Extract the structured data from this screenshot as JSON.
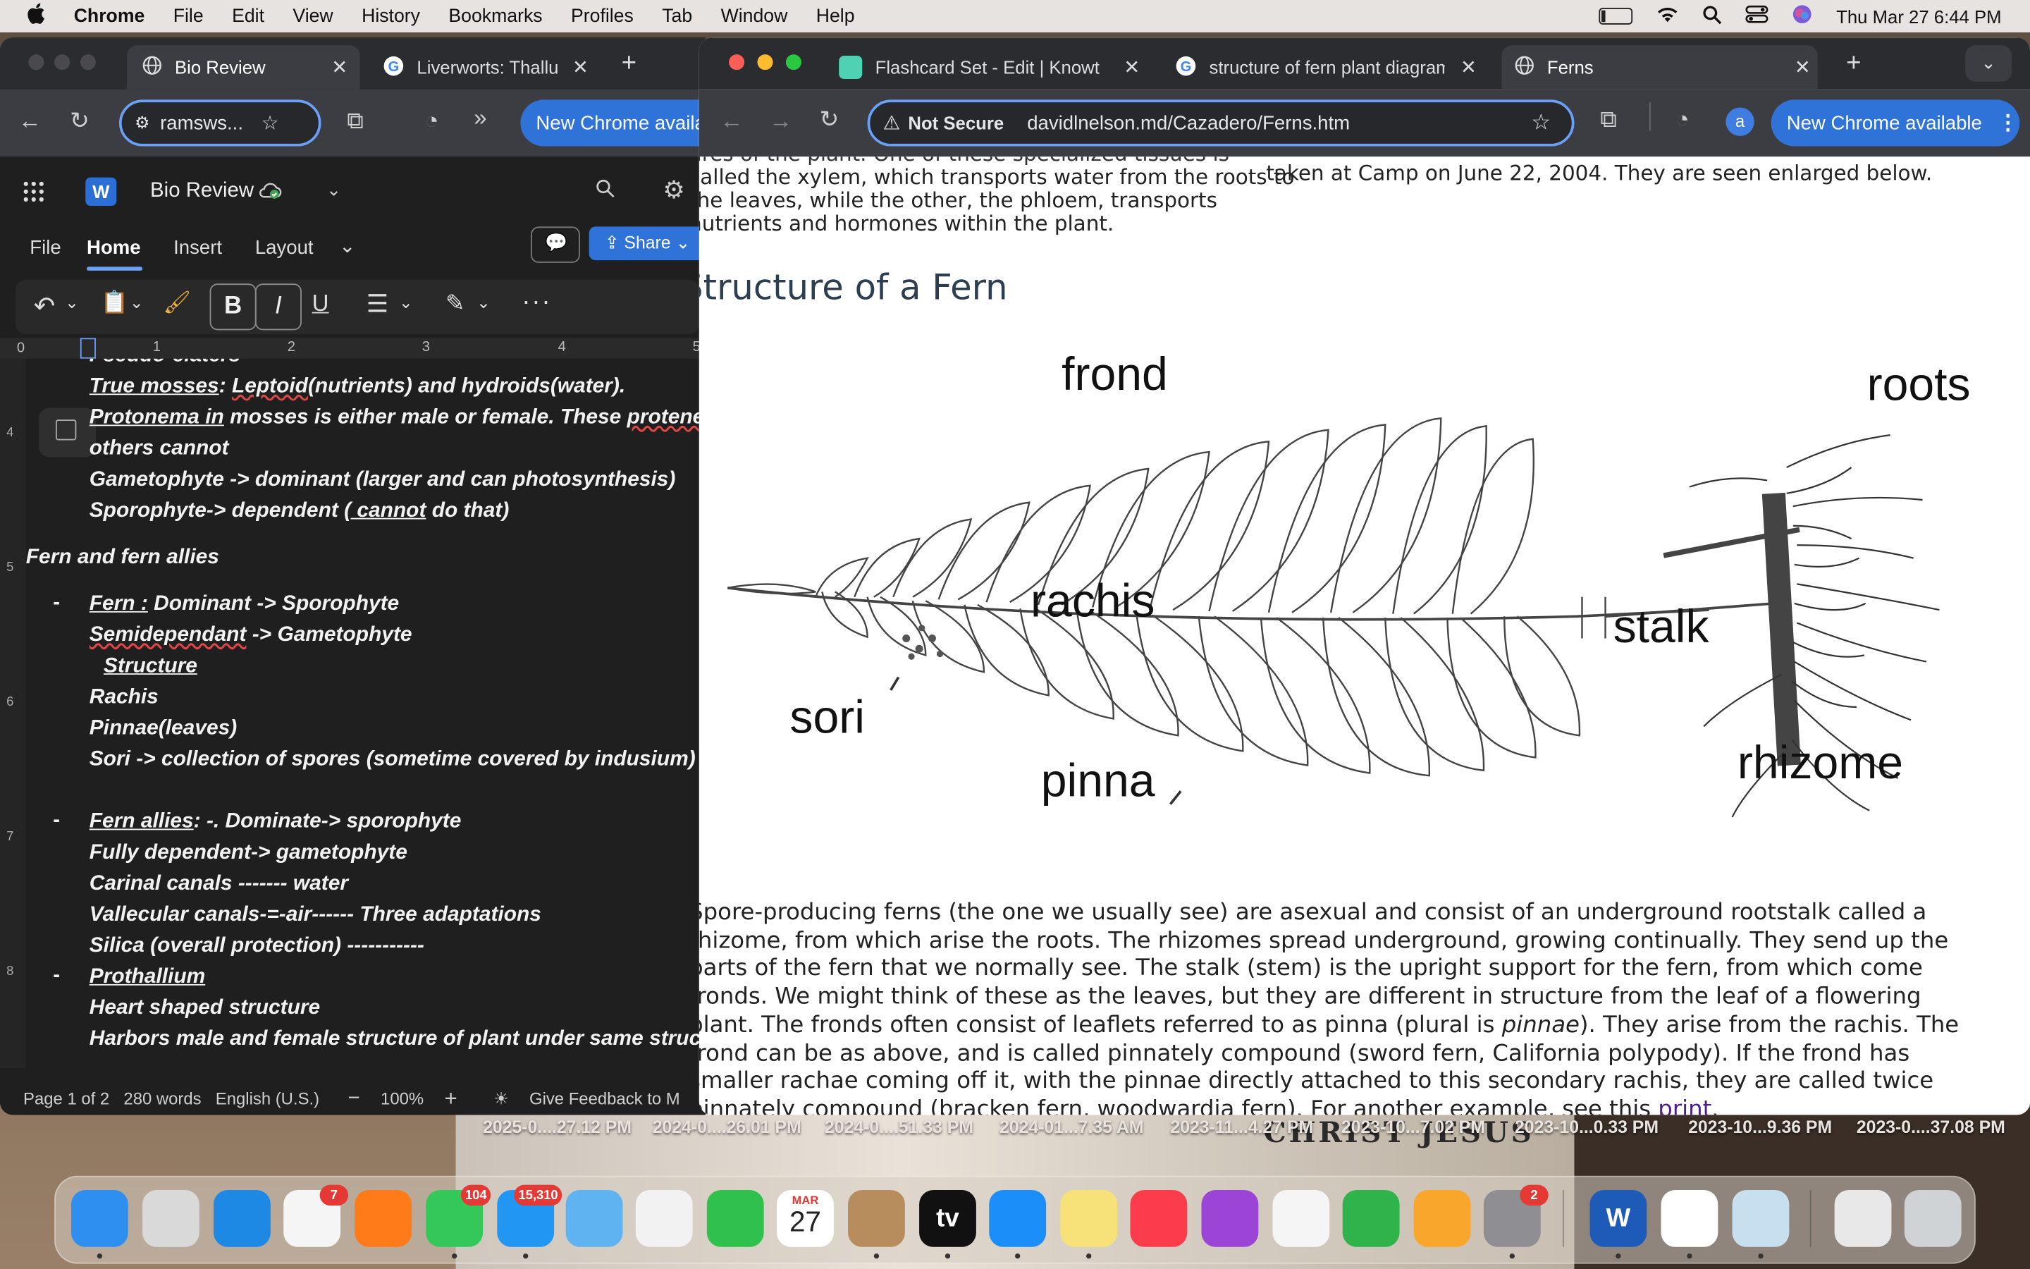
{
  "menubar": {
    "apple": "",
    "app": "Chrome",
    "items": [
      "File",
      "Edit",
      "View",
      "History",
      "Bookmarks",
      "Profiles",
      "Tab",
      "Window",
      "Help"
    ],
    "datetime": "Thu Mar 27  6:44 PM"
  },
  "word_browser": {
    "tabs": [
      {
        "title": "Bio Review",
        "icon": "globe-icon"
      },
      {
        "title": "Liverworts: Thallu",
        "icon": "google-icon"
      }
    ],
    "address": "ramsws...",
    "update_label": "New Chrome availa"
  },
  "word": {
    "doc_title": "Bio Review",
    "menu": [
      "File",
      "Home",
      "Insert",
      "Layout"
    ],
    "share_label": "Share",
    "ruler_marks": [
      "1",
      "2",
      "3",
      "4",
      "5"
    ],
    "margin_nums": [
      "4",
      "5",
      "6",
      "7",
      "8"
    ],
    "lines": {
      "l0": "Pseudo-elaters",
      "l1a": "True mosses",
      "l1b": ": ",
      "l1c": "Leptoid",
      "l1d": "(nutrients) and hydroids(water).",
      "l2a": "Protonema  in",
      "l2b": " mosses is either male or female. These ",
      "l2c": "protene",
      "l3": "others cannot",
      "l4": "Gametophyte -> dominant (larger and can photosynthesis)",
      "l5a": "Sporophyte-> dependent ",
      "l5b": "( cannot",
      "l5c": " do that)",
      "l6": "Fern and fern allies",
      "l7a": "Fern :",
      "l7b": " Dominant -> Sporophyte",
      "l8a": "Semidependant",
      "l8b": " -> Gametophyte",
      "l9": " Structure",
      "l10": "Rachis",
      "l11": "Pinnae(leaves)",
      "l12": "Sori -> collection of spores (sometime covered by indusium)",
      "l13a": "Fern allies",
      "l13b": ": -. Dominate-> sporophyte",
      "l14": "Fully dependent-> gametophyte",
      "l15": "Carinal canals ------- water",
      "l16": "Vallecular canals-=-air------ Three adaptations",
      "l17": "Silica (overall protection) -----------",
      "l18": "Prothallium",
      "l19": "Heart shaped structure",
      "l20": "Harbors male and female structure of plant under same struc"
    },
    "bullet_char": "-",
    "status": {
      "page": "Page 1 of 2",
      "words": "280 words",
      "lang": "English (U.S.)",
      "zoom": "100%",
      "feedback": "Give Feedback to M"
    }
  },
  "chrome": {
    "tabs": [
      {
        "title": "Flashcard Set - Edit | Knowt",
        "icon": "knowt-icon"
      },
      {
        "title": "structure of fern plant diagram",
        "icon": "google-icon"
      },
      {
        "title": "Ferns",
        "icon": "globe-icon",
        "active": true
      }
    ],
    "security": "Not Secure",
    "url": "davidlnelson.md/Cazadero/Ferns.htm",
    "profile_initial": "a",
    "update_label": "New Chrome available"
  },
  "page": {
    "top_left_lines": [
      "called the xylem, which transports water from the roots to",
      "the leaves, while the other, the phloem, transports",
      "nutrients and hormones within the plant."
    ],
    "top_right": "taken at Camp on June 22, 2004. They are seen enlarged below.",
    "heading": "Structure of a Fern",
    "labels": {
      "frond": "frond",
      "roots": "roots",
      "rachis": "rachis",
      "stalk": "stalk",
      "sori": "sori",
      "pinna": "pinna",
      "rhizome": "rhizome"
    },
    "para": [
      "Spore-producing ferns (the one we usually see) are asexual and consist of an underground rootstalk called a",
      "rhizome, from which arise the roots. The rhizomes spread underground, growing continually. They send up the",
      "parts of the fern that we normally see. The stalk (stem) is the upright support for the fern, from which come",
      "fronds. We might think of these as the leaves, but they are different in structure from the leaf of a flowering",
      "plant. The fronds often consist of leaflets referred to as pinna (plural is ",
      "pinnae",
      "). They arise from the rachis. The",
      "frond can be as above, and is called pinnately compound (sword fern, California polypody). If the frond has",
      "smaller rachae coming off it, with the pinnae directly attached to this secondary rachis, they are called twice",
      "pinnately compound (bracken fern, woodwardia fern). For another example, see this ",
      "print",
      "."
    ]
  },
  "desktop": {
    "labels": [
      "2025-0....27.12 PM",
      "2024-0....26.01 PM",
      "2024-0....51.33 PM",
      "2024-01...7.35 AM",
      "2023-11...4.27 PM",
      "2023-10...7.02 PM",
      "2023-10...0.33 PM",
      "2023-10...9.36 PM",
      "2023-0....37.08 PM"
    ],
    "image_text": "CHRIST JESUS"
  },
  "dock": {
    "apps": [
      {
        "name": "Finder",
        "icon": "finder-icon",
        "color": "#2f8ff0"
      },
      {
        "name": "Launchpad",
        "icon": "launchpad-icon",
        "color": "#d9d9d9"
      },
      {
        "name": "Safari",
        "icon": "safari-icon",
        "color": "#1e88e5"
      },
      {
        "name": "Reminders",
        "icon": "reminders-icon",
        "color": "#f5f5f5",
        "badge": "7"
      },
      {
        "name": "Firefox",
        "icon": "firefox-icon",
        "color": "#ff7a18"
      },
      {
        "name": "Messages",
        "icon": "messages-icon",
        "color": "#34c759",
        "badge": "104"
      },
      {
        "name": "Mail",
        "icon": "mail-icon",
        "color": "#2196f3",
        "badge": "15,310"
      },
      {
        "name": "Maps",
        "icon": "maps-icon",
        "color": "#5fb3f0"
      },
      {
        "name": "Photos",
        "icon": "photos-icon",
        "color": "#f2f2f2"
      },
      {
        "name": "FaceTime",
        "icon": "facetime-icon",
        "color": "#30c04d"
      },
      {
        "name": "Calendar",
        "icon": "calendar-icon",
        "color": "#ffffff",
        "month": "MAR",
        "day": "27"
      },
      {
        "name": "Contacts",
        "icon": "contacts-icon",
        "color": "#b88d5e"
      },
      {
        "name": "TV",
        "icon": "tv-icon",
        "color": "#111111",
        "text": "tv"
      },
      {
        "name": "App Store",
        "icon": "appstore-icon",
        "color": "#1c8ef9"
      },
      {
        "name": "Notes",
        "icon": "notes-icon",
        "color": "#f7e27a"
      },
      {
        "name": "Music",
        "icon": "music-icon",
        "color": "#fa3c4c"
      },
      {
        "name": "Podcasts",
        "icon": "podcasts-icon",
        "color": "#9b45d6"
      },
      {
        "name": "News",
        "icon": "news-icon",
        "color": "#f5f5f5"
      },
      {
        "name": "Numbers",
        "icon": "numbers-icon",
        "color": "#2fb34a"
      },
      {
        "name": "Pages",
        "icon": "pages-icon",
        "color": "#f8a72c"
      },
      {
        "name": "System Settings",
        "icon": "settings-icon",
        "color": "#8e8e93",
        "badge": "2"
      },
      {
        "name": "Word",
        "icon": "word-icon",
        "color": "#1e5bb8",
        "text": "W"
      },
      {
        "name": "Chrome",
        "icon": "chrome-icon",
        "color": "#ffffff"
      },
      {
        "name": "Preview",
        "icon": "preview-icon",
        "color": "#c8dff0"
      },
      {
        "name": "Downloads",
        "icon": "downloads-stack-icon",
        "color": "#e8e8e8"
      },
      {
        "name": "Trash",
        "icon": "trash-icon",
        "color": "#cfd3d6"
      }
    ]
  },
  "colors": {
    "chrome_dark": "#3c3d42",
    "chrome_accent": "#2f72d8",
    "word_bg": "#1f1f1f",
    "link": "#4a1f8a"
  }
}
